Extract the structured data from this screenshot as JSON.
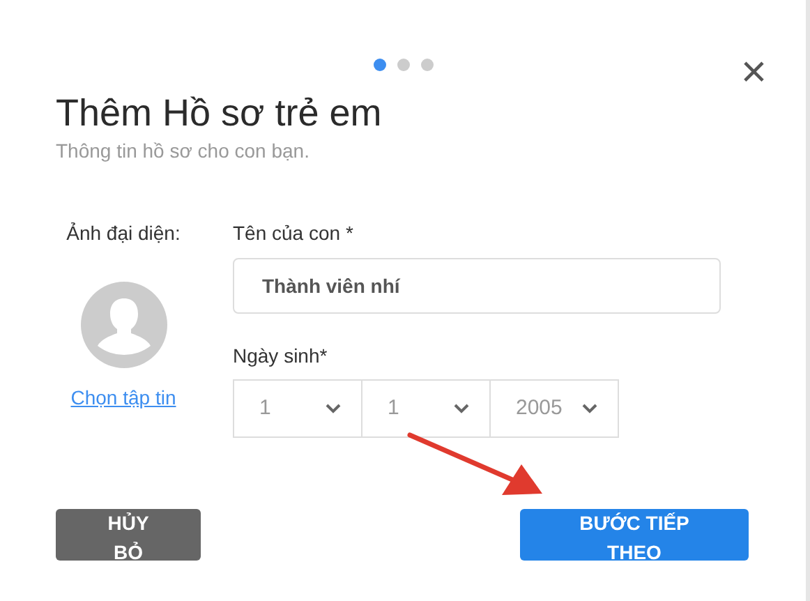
{
  "steps": [
    {
      "selected": true
    },
    {
      "selected": false
    },
    {
      "selected": false
    }
  ],
  "close": "×",
  "title": "Thêm Hồ sơ trẻ em",
  "subtitle": "Thông tin hồ sơ cho con bạn.",
  "avatar": {
    "label": "Ảnh đại diện:",
    "link": "Chọn tập tin"
  },
  "name_field": {
    "label": "Tên của con *",
    "value": "Thành viên nhí"
  },
  "birth_date": {
    "label": "Ngày sinh*",
    "selects": [
      {
        "value": "1"
      },
      {
        "value": "1"
      },
      {
        "value": "2005"
      }
    ]
  },
  "buttons": [
    {
      "kind": "secondary",
      "label": "HỦY BỎ"
    },
    {
      "kind": "primary",
      "label": "BƯỚC TIẾP THEO"
    }
  ]
}
